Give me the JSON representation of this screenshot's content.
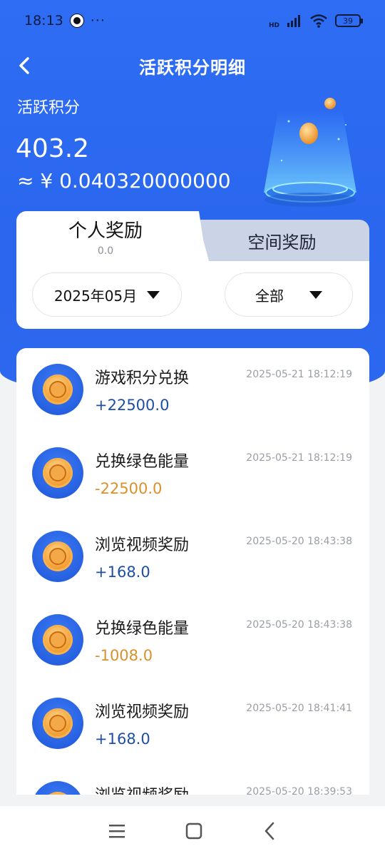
{
  "status_bar": {
    "time": "18:13",
    "more": "···",
    "network": "HD",
    "battery": "39"
  },
  "header": {
    "title": "活跃积分明细",
    "back_icon": "chevron-left-icon"
  },
  "summary": {
    "label": "活跃积分",
    "points": "403.2",
    "money": "≈ ¥ 0.040320000000"
  },
  "tabs": [
    {
      "label": "个人奖励",
      "sub": "0.0",
      "active": true
    },
    {
      "label": "空间奖励",
      "active": false
    }
  ],
  "filters": {
    "month": "2025年05月",
    "type": "全部"
  },
  "records": [
    {
      "title": "游戏积分兑换",
      "time": "2025-05-21 18:12:19",
      "amount": "+22500.0",
      "sign": "pos"
    },
    {
      "title": "兑换绿色能量",
      "time": "2025-05-21 18:12:19",
      "amount": "-22500.0",
      "sign": "neg"
    },
    {
      "title": "浏览视频奖励",
      "time": "2025-05-20 18:43:38",
      "amount": "+168.0",
      "sign": "pos"
    },
    {
      "title": "兑换绿色能量",
      "time": "2025-05-20 18:43:38",
      "amount": "-1008.0",
      "sign": "neg"
    },
    {
      "title": "浏览视频奖励",
      "time": "2025-05-20 18:41:41",
      "amount": "+168.0",
      "sign": "pos"
    },
    {
      "title": "浏览视频奖励",
      "time": "2025-05-20 18:39:53",
      "amount": "",
      "sign": "pos"
    }
  ],
  "colors": {
    "primary_blue": "#2f6df5",
    "positive": "#1e4fa8",
    "negative": "#d9912b"
  }
}
